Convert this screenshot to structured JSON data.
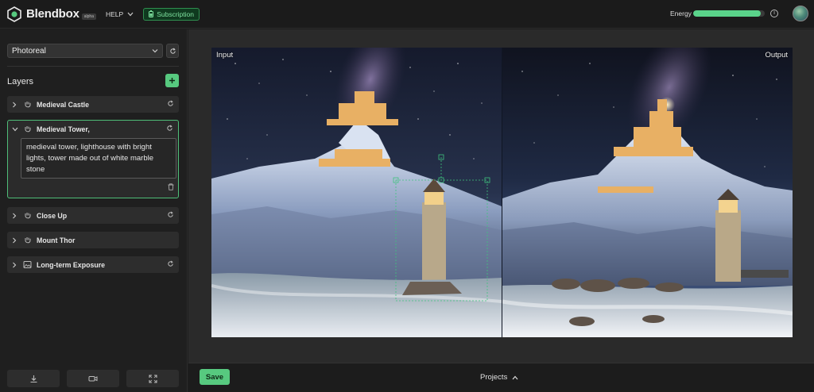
{
  "app": {
    "name": "Blendbox",
    "badge": "alpha",
    "help_label": "HELP",
    "subscription_label": "Subscription",
    "energy_label": "Energy",
    "energy_level": 0.94,
    "info_glyph": "i"
  },
  "sidebar": {
    "style_value": "Photoreal",
    "layers_title": "Layers",
    "layers": [
      {
        "name": "Medieval Castle",
        "icon": "hand-icon",
        "expanded": false
      },
      {
        "name": "Medieval Tower,",
        "icon": "hand-icon",
        "expanded": true,
        "prompt": "medieval tower, lighthouse with bright lights, tower made out of white marble stone"
      },
      {
        "name": "Close Up",
        "icon": "hand-icon",
        "expanded": false
      },
      {
        "name": "Mount Thor",
        "icon": "hand-icon",
        "expanded": false
      },
      {
        "name": "Long-term Exposure",
        "icon": "image-icon",
        "expanded": false
      }
    ],
    "bottom_buttons": [
      "download-icon",
      "camera-icon",
      "expand-icon"
    ]
  },
  "canvas": {
    "input_label": "Input",
    "output_label": "Output"
  },
  "footer": {
    "save_label": "Save",
    "projects_label": "Projects"
  },
  "colors": {
    "accent": "#57c97f",
    "background": "#1e1e1e"
  }
}
